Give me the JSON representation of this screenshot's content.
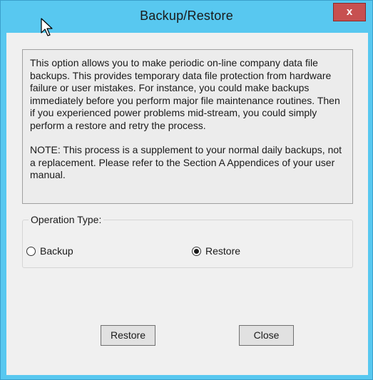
{
  "window": {
    "title": "Backup/Restore",
    "close_label": "x"
  },
  "info": {
    "paragraph1": "This option allows you to make periodic on-line company data file backups. This provides temporary data file protection from hardware failure or user mistakes. For instance, you could make backups immediately before you perform major file maintenance routines. Then if you experienced power problems mid-stream, you could simply perform a restore and retry the process.",
    "paragraph2": "NOTE: This process is a supplement to your normal daily backups, not a replacement. Please refer to the Section A Appendices of your user manual."
  },
  "operation": {
    "legend": "Operation Type:",
    "options": [
      {
        "label": "Backup",
        "selected": false
      },
      {
        "label": "Restore",
        "selected": true
      }
    ]
  },
  "buttons": {
    "restore_label": "Restore",
    "close_label": "Close"
  },
  "icons": {
    "cursor": "mouse-pointer-icon",
    "close": "close-icon"
  },
  "colors": {
    "titlebar": "#58c8f0",
    "close_button": "#c75050",
    "client_background": "#f0f0f0"
  }
}
